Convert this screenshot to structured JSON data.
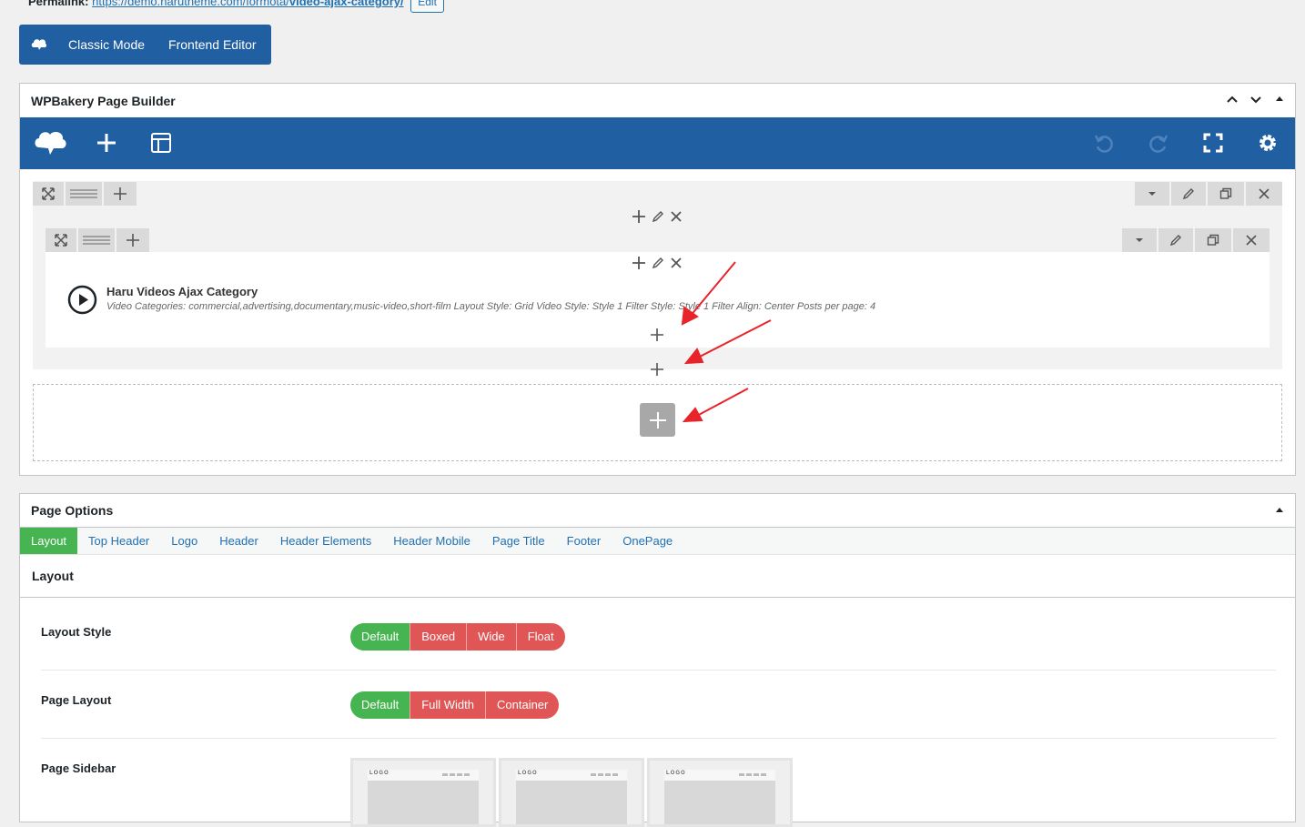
{
  "permalink": {
    "label": "Permalink:",
    "url_base": "https://demo.harutheme.com/formota/",
    "url_slug": "video-ajax-category/",
    "edit_label": "Edit"
  },
  "modebar": {
    "classic_label": "Classic Mode",
    "frontend_label": "Frontend Editor"
  },
  "builder": {
    "title": "WPBakery Page Builder",
    "element": {
      "title": "Haru Videos Ajax Category",
      "description": "Video Categories: commercial,advertising,documentary,music-video,short-film  Layout Style: Grid  Video Style: Style 1  Filter Style: Style 1  Filter Align: Center  Posts per page: 4"
    }
  },
  "page_options": {
    "title": "Page Options",
    "tabs": [
      "Layout",
      "Top Header",
      "Logo",
      "Header",
      "Header Elements",
      "Header Mobile",
      "Page Title",
      "Footer",
      "OnePage"
    ],
    "active_tab": "Layout",
    "section_title": "Layout",
    "fields": {
      "layout_style": {
        "label": "Layout Style",
        "options": [
          "Default",
          "Boxed",
          "Wide",
          "Float"
        ],
        "selected": "Default"
      },
      "page_layout": {
        "label": "Page Layout",
        "options": [
          "Default",
          "Full Width",
          "Container"
        ],
        "selected": "Default"
      },
      "page_sidebar": {
        "label": "Page Sidebar",
        "thumb_text": "LOGO"
      }
    }
  },
  "colors": {
    "builder_blue": "#1f5fa2",
    "active_green": "#46b450",
    "inactive_red": "#e05555",
    "annotation_red": "#e8242a"
  }
}
